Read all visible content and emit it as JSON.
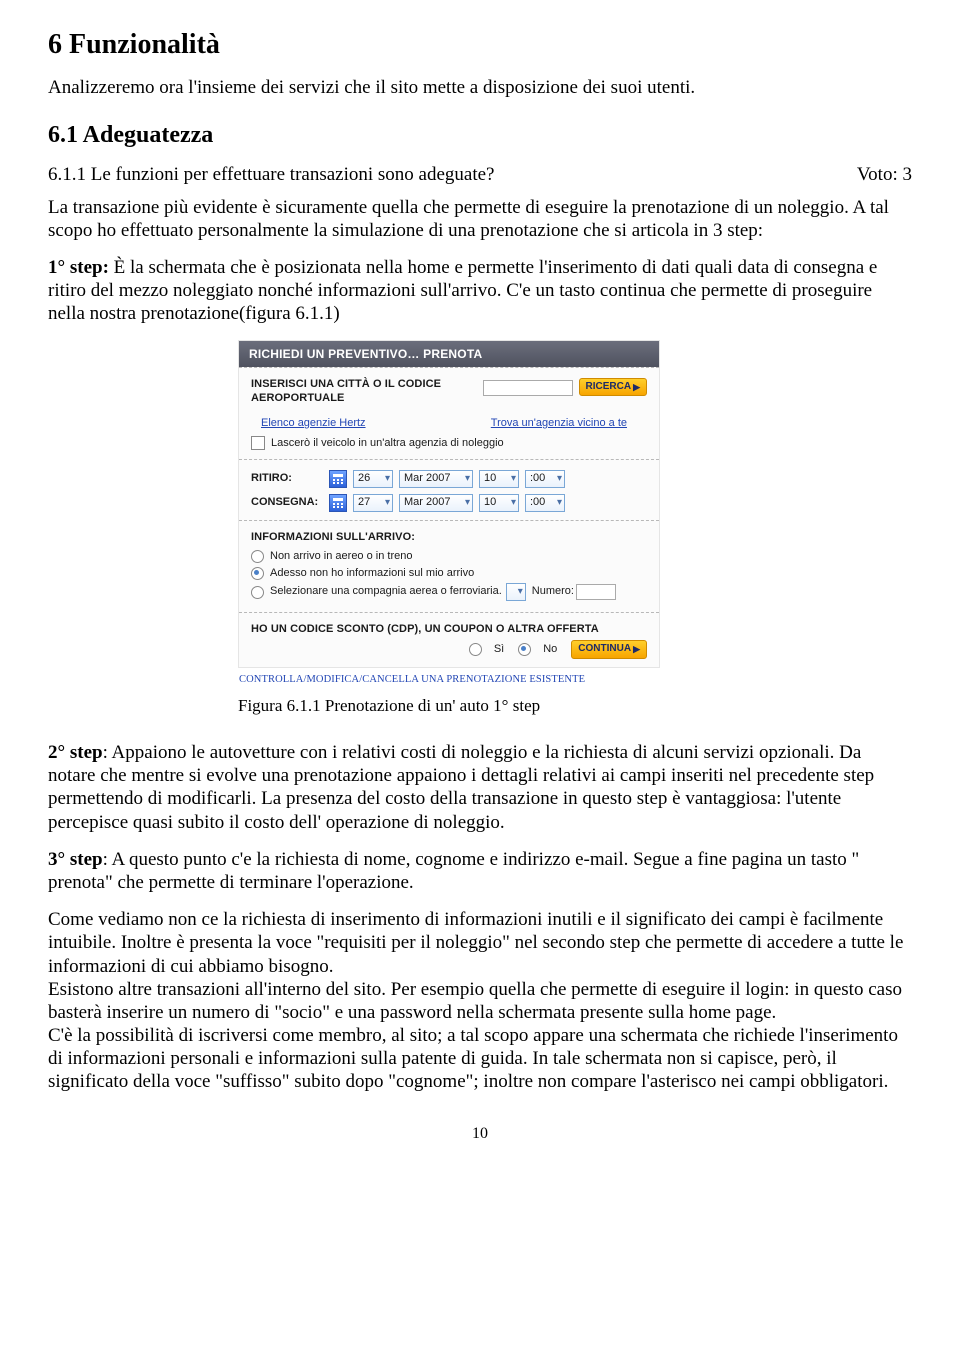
{
  "h1": "6 Funzionalità",
  "intro": "Analizzeremo ora l'insieme dei servizi che il sito mette a disposizione dei suoi utenti.",
  "h2": "6.1 Adeguatezza",
  "subhead": {
    "left": "6.1.1 Le funzioni per effettuare transazioni sono adeguate?",
    "right": "Voto: 3"
  },
  "para1": "La transazione più evidente è sicuramente quella che permette di eseguire la prenotazione di un noleggio. A tal scopo ho effettuato personalmente la simulazione di una prenotazione che si articola in 3 step:",
  "para2_lead": "1° step:",
  "para2_body": " È la schermata che è posizionata nella home e permette l'inserimento di dati quali data di consegna e ritiro del mezzo noleggiato nonché informazioni sull'arrivo. C'e un tasto continua che permette di proseguire nella nostra prenotazione(figura 6.1.1)",
  "widget": {
    "bar_title": "RICHIEDI UN PREVENTIVO… PRENOTA",
    "loc_label": "INSERISCI UNA CITTÀ O IL CODICE AEROPORTUALE",
    "ricerca_btn": "RICERCA",
    "link_elenco": "Elenco agenzie Hertz",
    "link_trova": "Trova un'agenzia vicino a te",
    "checkbox_label": "Lascerò il veicolo in un'altra agenzia di noleggio",
    "ritiro_label": "RITIRO:",
    "consegna_label": "CONSEGNA:",
    "ritiro": {
      "day": "26",
      "month": "Mar 2007",
      "hour": "10",
      "min": ":00"
    },
    "consegna": {
      "day": "27",
      "month": "Mar 2007",
      "hour": "10",
      "min": ":00"
    },
    "arrivo_title": "INFORMAZIONI SULL'ARRIVO:",
    "opt1": "Non arrivo in aereo o in treno",
    "opt2": "Adesso non ho informazioni sul mio arrivo",
    "opt3": "Selezionare una compagnia aerea o ferroviaria.",
    "numero_label": "Numero:",
    "sconto_title": "HO UN CODICE SCONTO (CDP), UN COUPON O ALTRA OFFERTA",
    "si": "Sì",
    "no": "No",
    "continua_btn": "CONTINUA",
    "footer_link": "CONTROLLA/MODIFICA/CANCELLA UNA PRENOTAZIONE ESISTENTE"
  },
  "caption": "Figura 6.1.1 Prenotazione di un' auto 1° step",
  "para3_lead": "2° step",
  "para3_body": ": Appaiono le autovetture con i relativi costi di noleggio e la richiesta di alcuni servizi opzionali. Da notare che mentre si evolve una prenotazione appaiono i dettagli relativi ai campi inseriti nel precedente step permettendo di modificarli. La presenza del costo della transazione in questo step è vantaggiosa: l'utente percepisce quasi subito il costo dell' operazione di noleggio.",
  "para4_lead": "3° step",
  "para4_body": ": A questo punto c'e la richiesta di nome, cognome e indirizzo e-mail. Segue a fine pagina un tasto \" prenota\" che permette di terminare l'operazione.",
  "para5": "Come vediamo non ce la richiesta di inserimento di informazioni inutili e il significato dei campi è facilmente intuibile. Inoltre è presenta la voce \"requisiti per il noleggio\" nel secondo step che permette di accedere a tutte le informazioni di cui abbiamo bisogno.",
  "para6": "Esistono altre transazioni all'interno del sito. Per esempio quella che permette di eseguire il login: in questo caso basterà inserire un numero di \"socio\" e una password nella schermata presente sulla home page.",
  "para7": "C'è la possibilità di iscriversi come membro, al sito; a tal scopo appare una schermata che richiede l'inserimento di informazioni personali e informazioni sulla patente di guida. In tale schermata non si capisce, però, il significato della voce \"suffisso\" subito dopo \"cognome\"; inoltre non compare l'asterisco nei campi obbligatori.",
  "page_number": "10"
}
